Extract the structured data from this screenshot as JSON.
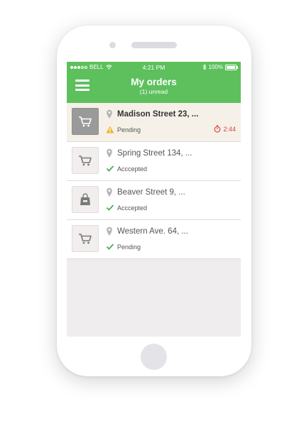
{
  "status_bar": {
    "carrier": "BELL",
    "time": "4:21 PM",
    "battery": "100%"
  },
  "header": {
    "title": "My orders",
    "subtitle": "(1) unread"
  },
  "orders": [
    {
      "address": "Madison Street 23, ...",
      "status": "Pending",
      "timer": "2:44",
      "icon": "cart-icon"
    },
    {
      "address": "Spring Street 134, ...",
      "status": "Acccepted",
      "icon": "cart-icon"
    },
    {
      "address": "Beaver Street 9, ...",
      "status": "Acccepted",
      "icon": "shopping-bag-icon"
    },
    {
      "address": "Western Ave. 64, ...",
      "status": "Pending",
      "icon": "cart-icon"
    }
  ],
  "colors": {
    "header_green": "#5dc05d",
    "accent_check": "#46b14a",
    "warning": "#f0b429",
    "timer_red": "#d6443a"
  }
}
